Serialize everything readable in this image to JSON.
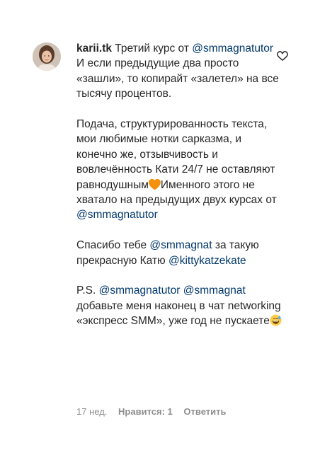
{
  "comment": {
    "username": "karii.tk",
    "intro": " Третий курс от ",
    "mention_1": "@smmagnatutor",
    "line_after_mention_1": "И если предыдущие два просто «зашли», то копирайт «залетел» на все тысячу процентов.",
    "para_2_start": "Подача, структурированность текста, мои любимые нотки сарказма, и конечно же, отзывчивость и вовлечённость Кати 24/7 не оставляют равнодушным",
    "para_2_emoji": "orange-heart-icon",
    "para_2_mid": "Именного этого не хватало на предыдущих двух курсах от ",
    "mention_2": "@smmagnatutor",
    "para_3_start": "Спасибо тебе ",
    "mention_3": "@smmagnat",
    "para_3_mid": " за такую прекрасную Катю ",
    "mention_4": "@kittykatzekate",
    "para_4_start": "P.S. ",
    "mention_5": "@smmagnatutor",
    "para_4_space": " ",
    "mention_6": "@smmagnat",
    "para_4_rest": " добавьте меня наконец в чат networking «экспресс SMM», уже год не пускаете",
    "para_4_emoji": "sweat-smile-icon"
  },
  "meta": {
    "time": "17 нед.",
    "likes": "Нравится: 1",
    "reply": "Ответить"
  },
  "colors": {
    "text": "#262626",
    "mention": "#00376b",
    "meta": "#8e8e8e",
    "heart_emoji": "#f4900c",
    "smile_emoji": "#ffcc4d"
  }
}
